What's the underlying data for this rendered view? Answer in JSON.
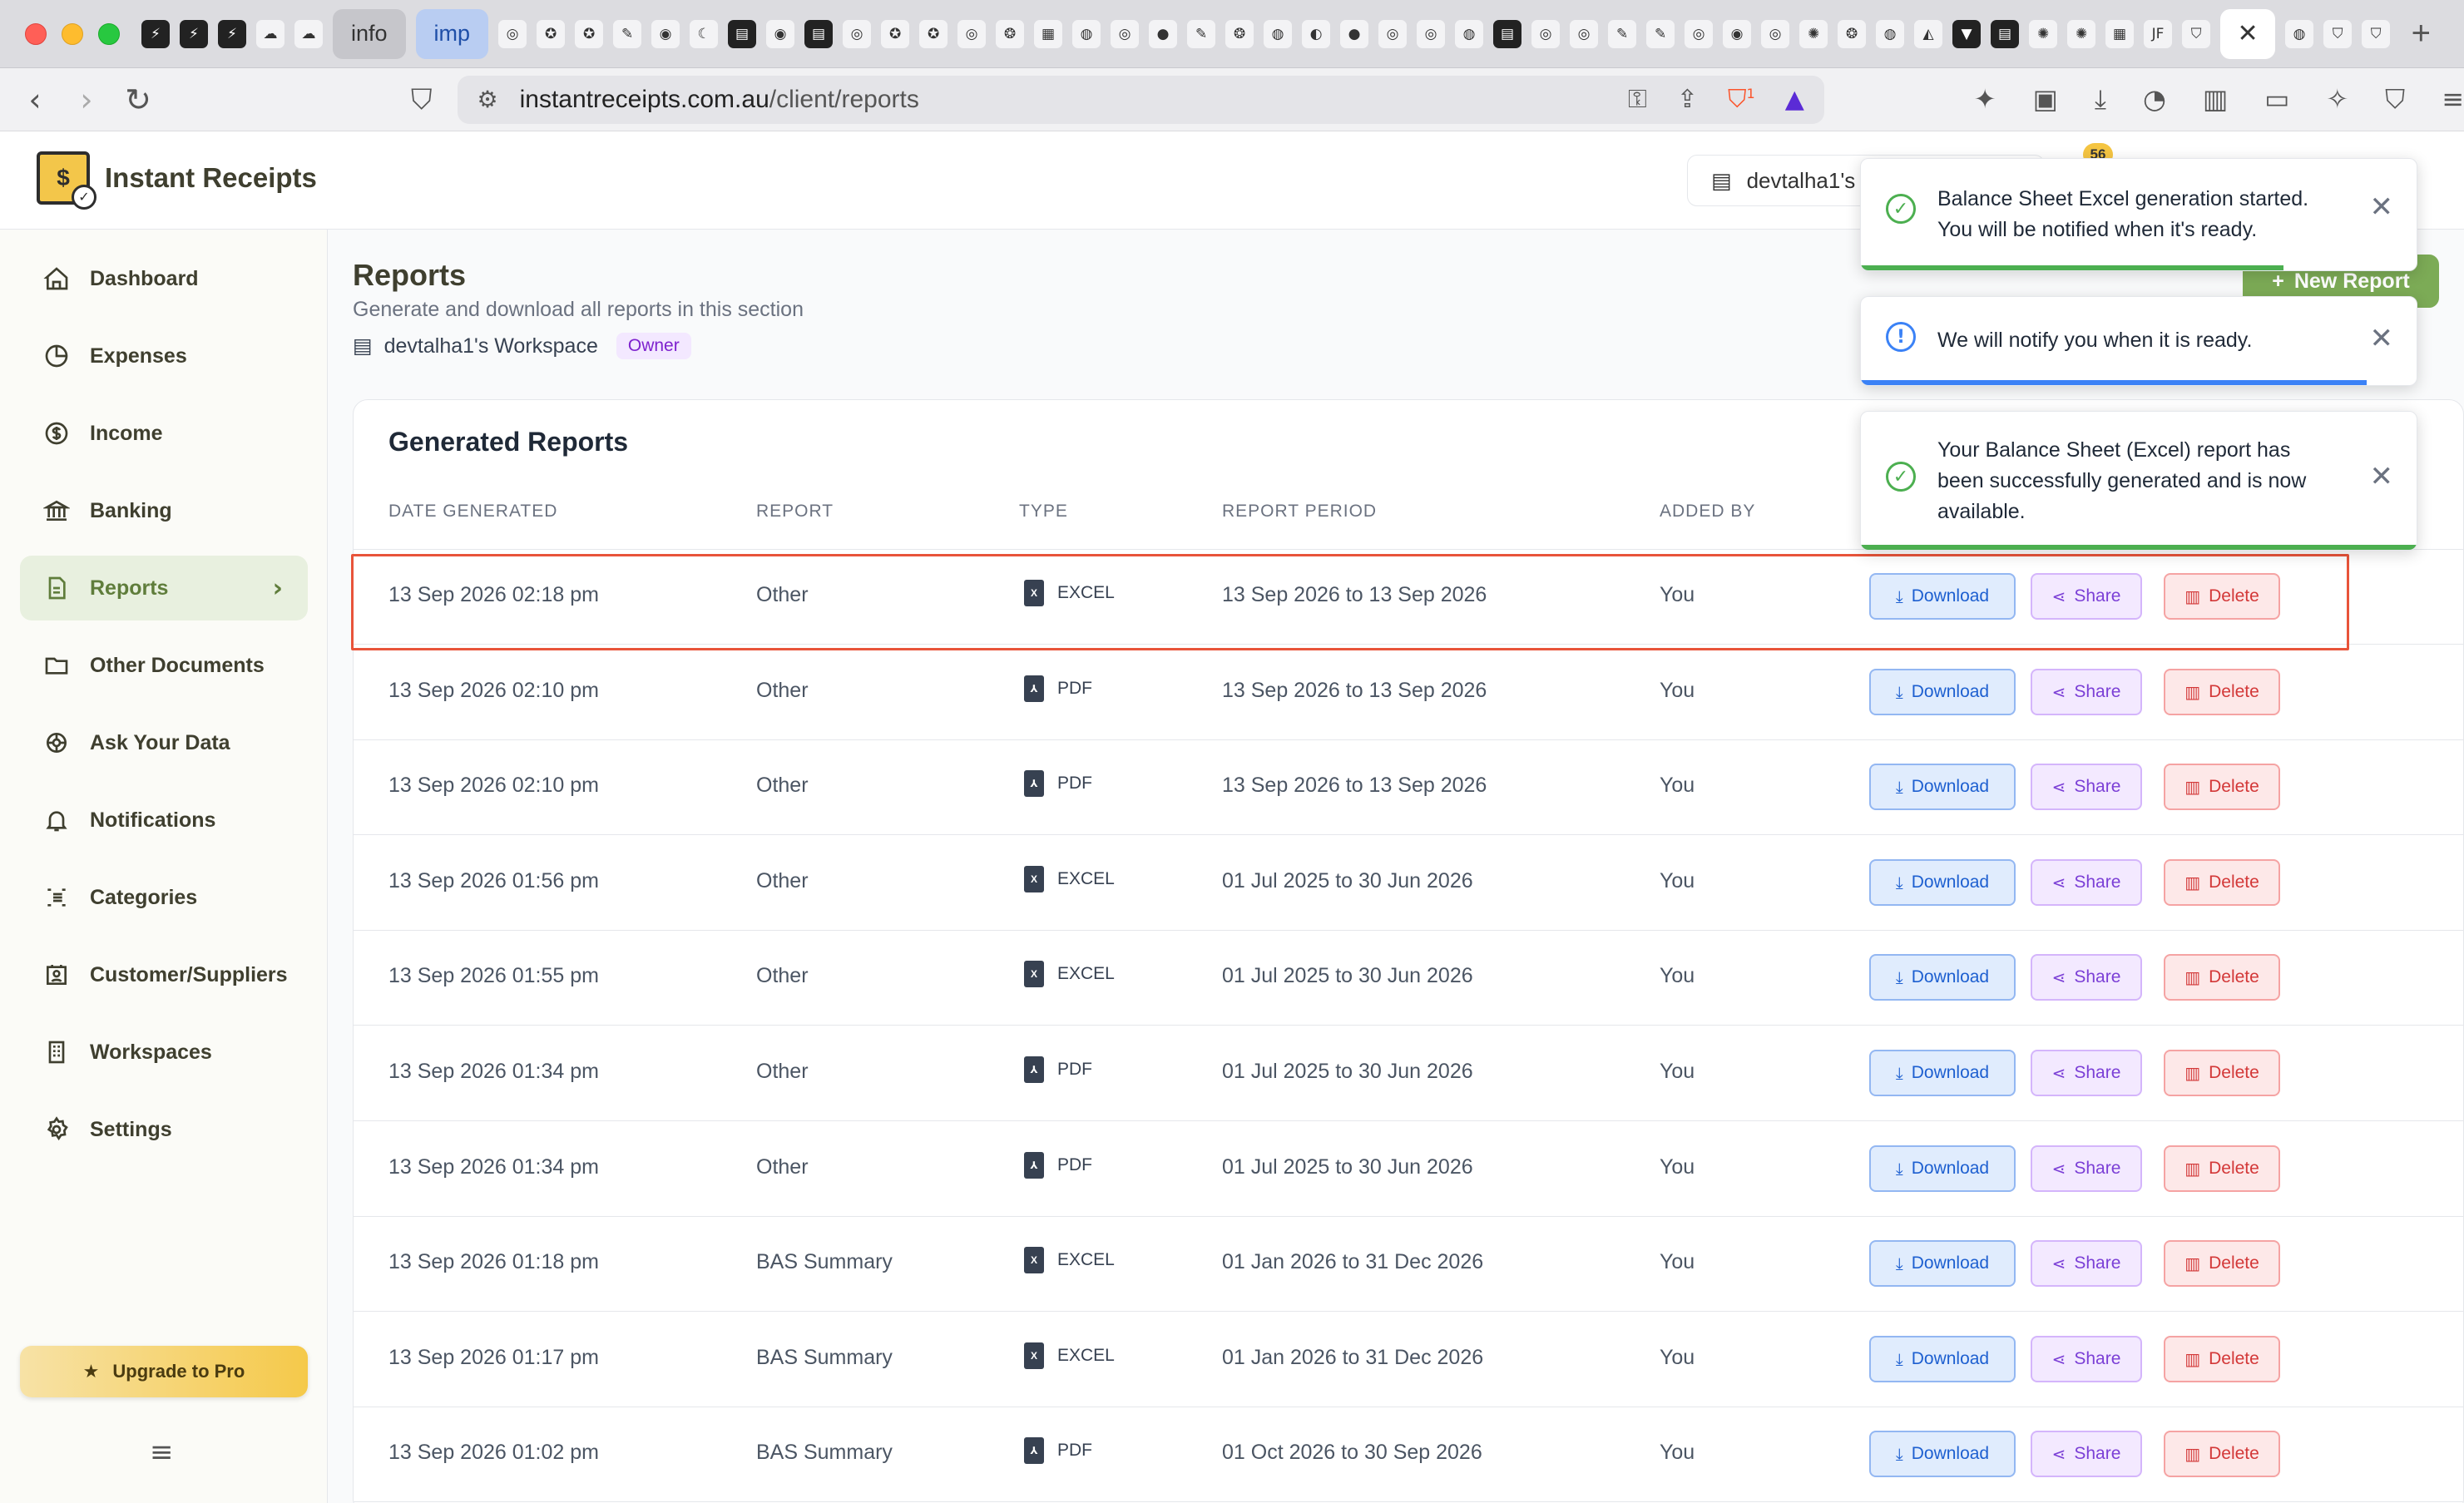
{
  "browser": {
    "tabs": {
      "info": "info",
      "imp": "imp",
      "jf": "JF"
    },
    "url_host": "instantreceipts.com.au",
    "url_path": "/client/reports",
    "brave_badge": "1"
  },
  "app": {
    "name": "Instant Receipts",
    "logo_glyph": "$",
    "workspace_pill": "devtalha1's",
    "notification_count": "56"
  },
  "sidebar": {
    "items": [
      {
        "label": "Dashboard",
        "icon": "home-icon"
      },
      {
        "label": "Expenses",
        "icon": "pie-chart-icon"
      },
      {
        "label": "Income",
        "icon": "dollar-circle-icon"
      },
      {
        "label": "Banking",
        "icon": "bank-icon"
      },
      {
        "label": "Reports",
        "icon": "document-icon",
        "active": true
      },
      {
        "label": "Other Documents",
        "icon": "folder-icon"
      },
      {
        "label": "Ask Your Data",
        "icon": "ai-icon"
      },
      {
        "label": "Notifications",
        "icon": "bell-icon"
      },
      {
        "label": "Categories",
        "icon": "categories-icon"
      },
      {
        "label": "Customer/Suppliers",
        "icon": "contacts-icon"
      },
      {
        "label": "Workspaces",
        "icon": "workspaces-icon"
      },
      {
        "label": "Settings",
        "icon": "gear-icon"
      }
    ],
    "upgrade_label": "Upgrade to Pro"
  },
  "page": {
    "title": "Reports",
    "subtitle": "Generate and download all reports in this section",
    "workspace": "devtalha1's Workspace",
    "role": "Owner",
    "new_report": "New Report"
  },
  "table": {
    "title": "Generated Reports",
    "headers": [
      "DATE GENERATED",
      "REPORT",
      "TYPE",
      "REPORT PERIOD",
      "ADDED BY"
    ],
    "actions": {
      "download": "Download",
      "share": "Share",
      "delete": "Delete"
    },
    "rows": [
      {
        "date": "13 Sep 2026 02:18 pm",
        "report": "Other",
        "type": "EXCEL",
        "period": "13 Sep 2026 to 13 Sep 2026",
        "added_by": "You"
      },
      {
        "date": "13 Sep 2026 02:10 pm",
        "report": "Other",
        "type": "PDF",
        "period": "13 Sep 2026 to 13 Sep 2026",
        "added_by": "You"
      },
      {
        "date": "13 Sep 2026 02:10 pm",
        "report": "Other",
        "type": "PDF",
        "period": "13 Sep 2026 to 13 Sep 2026",
        "added_by": "You"
      },
      {
        "date": "13 Sep 2026 01:56 pm",
        "report": "Other",
        "type": "EXCEL",
        "period": "01 Jul 2025 to 30 Jun 2026",
        "added_by": "You"
      },
      {
        "date": "13 Sep 2026 01:55 pm",
        "report": "Other",
        "type": "EXCEL",
        "period": "01 Jul 2025 to 30 Jun 2026",
        "added_by": "You"
      },
      {
        "date": "13 Sep 2026 01:34 pm",
        "report": "Other",
        "type": "PDF",
        "period": "01 Jul 2025 to 30 Jun 2026",
        "added_by": "You"
      },
      {
        "date": "13 Sep 2026 01:34 pm",
        "report": "Other",
        "type": "PDF",
        "period": "01 Jul 2025 to 30 Jun 2026",
        "added_by": "You"
      },
      {
        "date": "13 Sep 2026 01:18 pm",
        "report": "BAS Summary",
        "type": "EXCEL",
        "period": "01 Jan 2026 to 31 Dec 2026",
        "added_by": "You"
      },
      {
        "date": "13 Sep 2026 01:17 pm",
        "report": "BAS Summary",
        "type": "EXCEL",
        "period": "01 Jan 2026 to 31 Dec 2026",
        "added_by": "You"
      },
      {
        "date": "13 Sep 2026 01:02 pm",
        "report": "BAS Summary",
        "type": "PDF",
        "period": "01 Oct 2026 to 30 Sep 2026",
        "added_by": "You"
      }
    ]
  },
  "toasts": [
    {
      "text": "Balance Sheet Excel generation started. You will be notified when it's ready.",
      "kind": "success",
      "progress": 0.76
    },
    {
      "text": "We will notify you when it is ready.",
      "kind": "info",
      "progress": 0.91
    },
    {
      "text": "Your Balance Sheet (Excel) report has been successfully generated and is now available.",
      "kind": "success",
      "progress": 1.0
    }
  ],
  "colors": {
    "accent": "#7cab56",
    "sidebar_active_bg": "#e8f0df",
    "highlight": "#e8543a",
    "download": "#1d5fd0",
    "share": "#7b3fd6",
    "delete": "#d33838"
  }
}
